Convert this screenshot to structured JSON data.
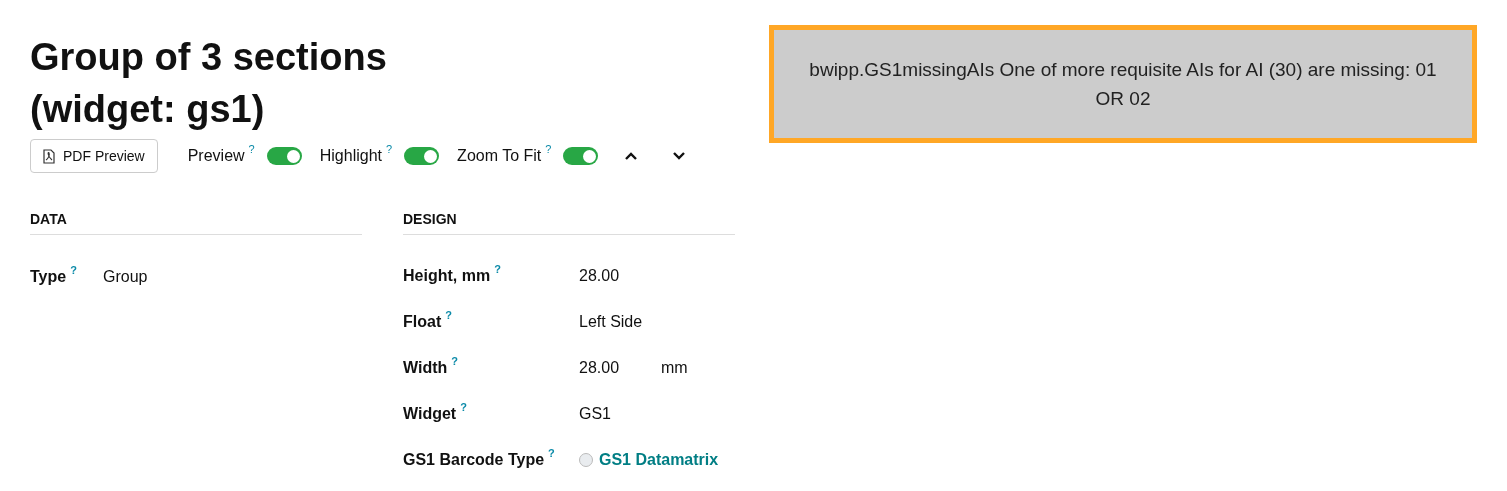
{
  "title": [
    "Group of 3 sections",
    "(widget: gs1)"
  ],
  "toolbar": {
    "pdf_button": "PDF Preview",
    "toggles": [
      {
        "label": "Preview",
        "help": "?",
        "on": true
      },
      {
        "label": "Highlight",
        "help": "?",
        "on": true
      },
      {
        "label": "Zoom To Fit",
        "help": "?",
        "on": true
      }
    ]
  },
  "data_section": {
    "heading": "DATA",
    "fields": [
      {
        "label": "Type",
        "help": "?",
        "value": "Group"
      }
    ]
  },
  "design_section": {
    "heading": "DESIGN",
    "fields": [
      {
        "kind": "text",
        "label": "Height, mm",
        "help": "?",
        "value": "28.00"
      },
      {
        "kind": "text",
        "label": "Float",
        "help": "?",
        "value": "Left Side"
      },
      {
        "kind": "text",
        "label": "Width",
        "help": "?",
        "value": "28.00",
        "unit": "mm"
      },
      {
        "kind": "text",
        "label": "Widget",
        "help": "?",
        "value": "GS1"
      },
      {
        "kind": "radio",
        "label": "GS1 Barcode Type",
        "help": "?",
        "value": "GS1 Datamatrix",
        "checked": false
      }
    ]
  },
  "error": {
    "message": "bwipp.GS1missingAIs One of more requisite AIs for AI (30) are missing: 01 OR 02"
  }
}
